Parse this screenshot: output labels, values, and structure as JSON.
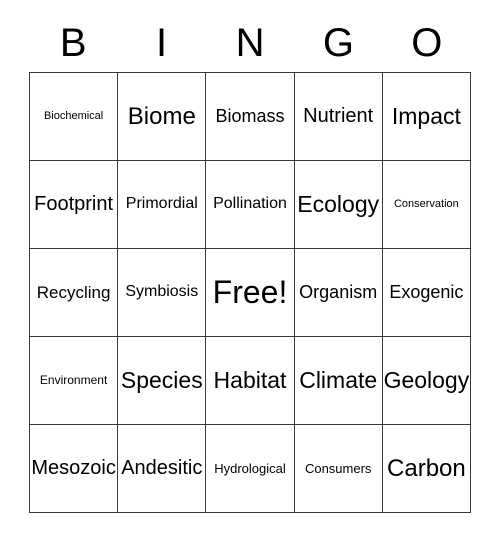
{
  "card": {
    "title": "BINGO",
    "header_letters": [
      "B",
      "I",
      "N",
      "G",
      "O"
    ],
    "grid": {
      "columns": 5,
      "rows": 5,
      "free_space": "Free!",
      "border_color": "#3a3a3a",
      "background_color": "#ffffff",
      "text_color": "#000000"
    },
    "cells": [
      [
        {
          "label": "Biochemical",
          "size": "fs-xs"
        },
        {
          "label": "Biome",
          "size": "fs-xxxl"
        },
        {
          "label": "Biomass",
          "size": "fs-l"
        },
        {
          "label": "Nutrient",
          "size": "fs-xl"
        },
        {
          "label": "Impact",
          "size": "fs-xxl"
        }
      ],
      [
        {
          "label": "Footprint",
          "size": "fs-xl"
        },
        {
          "label": "Primordial",
          "size": "fs-m"
        },
        {
          "label": "Pollination",
          "size": "fs-m"
        },
        {
          "label": "Ecology",
          "size": "fs-xxl"
        },
        {
          "label": "Conservation",
          "size": "fs-xs"
        }
      ],
      [
        {
          "label": "Recycling",
          "size": "fs-ml"
        },
        {
          "label": "Symbiosis",
          "size": "fs-m"
        },
        {
          "label": "Free!",
          "size": "fs-free"
        },
        {
          "label": "Organism",
          "size": "fs-l"
        },
        {
          "label": "Exogenic",
          "size": "fs-l"
        }
      ],
      [
        {
          "label": "Environment",
          "size": "fs-s"
        },
        {
          "label": "Species",
          "size": "fs-xxl"
        },
        {
          "label": "Habitat",
          "size": "fs-xxl"
        },
        {
          "label": "Climate",
          "size": "fs-xxl"
        },
        {
          "label": "Geology",
          "size": "fs-xxl"
        }
      ],
      [
        {
          "label": "Mesozoic",
          "size": "fs-xl"
        },
        {
          "label": "Andesitic",
          "size": "fs-xl"
        },
        {
          "label": "Hydrological",
          "size": "fs-sm"
        },
        {
          "label": "Consumers",
          "size": "fs-sm"
        },
        {
          "label": "Carbon",
          "size": "fs-xxxl"
        }
      ]
    ]
  }
}
